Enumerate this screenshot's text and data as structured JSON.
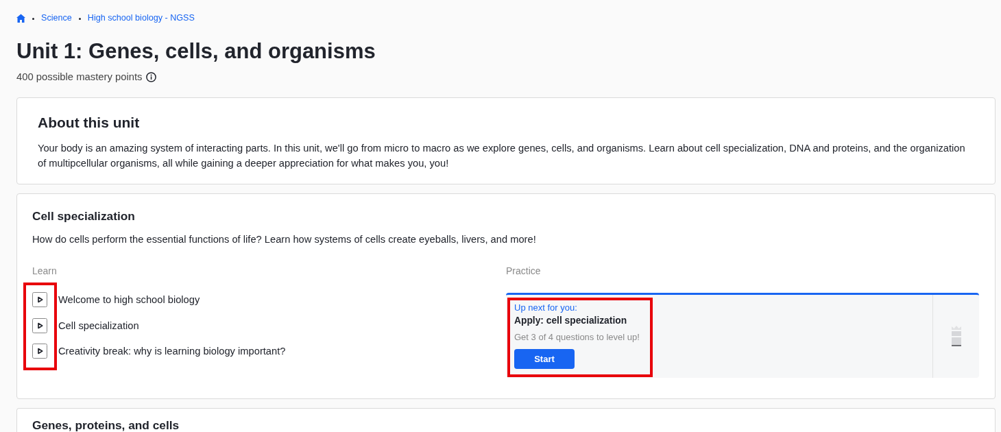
{
  "breadcrumb": [
    "Science",
    "High school biology - NGSS"
  ],
  "title": "Unit 1: Genes, cells, and organisms",
  "mastery_points": "400 possible mastery points",
  "about": {
    "heading": "About this unit",
    "text": "Your body is an amazing system of interacting parts. In this unit, we'll go from micro to macro as we explore genes, cells, and organisms. Learn about cell specialization, DNA and proteins, and the organization of multipcellular organisms, all while gaining a deeper appreciation for what makes you, you!"
  },
  "lessons": [
    {
      "heading": "Cell specialization",
      "description": "How do cells perform the essential functions of life? Learn how systems of cells create eyeballs, livers, and more!",
      "learn": {
        "label": "Learn",
        "highlighted": true,
        "items": [
          {
            "kind": "video",
            "title": "Welcome to high school biology"
          },
          {
            "kind": "video",
            "title": "Cell specialization"
          },
          {
            "kind": "video",
            "title": "Creativity break: why is learning biology important?"
          }
        ]
      },
      "practice": {
        "label": "Practice",
        "up_next": {
          "highlighted": true,
          "eyebrow": "Up next for you:",
          "title": "Apply: cell specialization",
          "hint": "Get 3 of 4 questions to level up!",
          "button": "Start"
        }
      }
    },
    {
      "heading": "Genes, proteins, and cells"
    }
  ]
}
